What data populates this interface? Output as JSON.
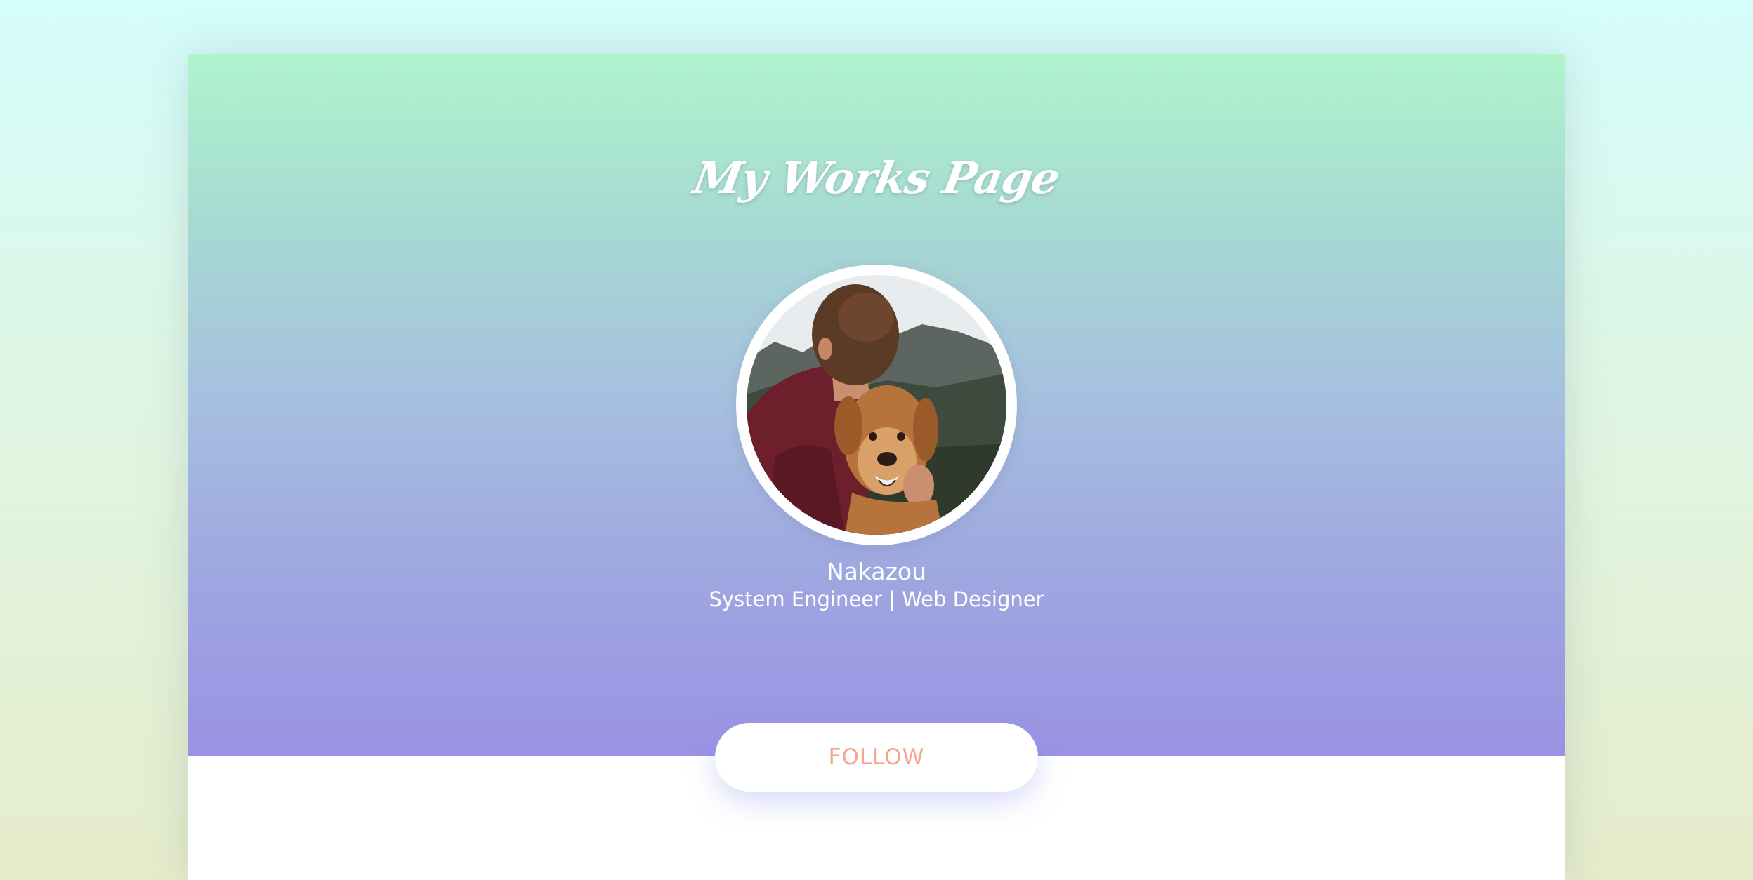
{
  "header": {
    "title": "My Works Page"
  },
  "profile": {
    "avatar_icon": "avatar-photo-man-hugging-dog",
    "name": "Nakazou",
    "role": "System Engineer | Web Designer"
  },
  "actions": {
    "follow_label": "FOLLOW"
  },
  "colors": {
    "background_top": "#d4fdfc",
    "background_bottom": "#e6eccb",
    "hero_top": "#b0f4cd",
    "hero_bottom": "#9a92e3",
    "follow_text": "#f6a38f",
    "text": "#ffffff"
  }
}
